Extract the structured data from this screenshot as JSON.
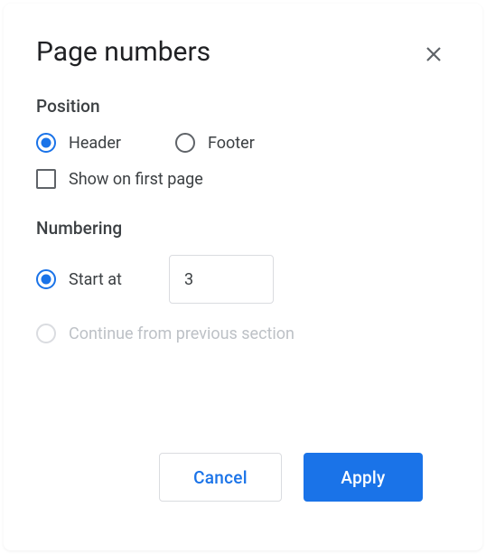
{
  "dialog": {
    "title": "Page numbers"
  },
  "position": {
    "section_label": "Position",
    "header_label": "Header",
    "footer_label": "Footer",
    "selected": "header",
    "show_first_label": "Show on first page",
    "show_first_checked": false
  },
  "numbering": {
    "section_label": "Numbering",
    "start_at_label": "Start at",
    "start_at_value": "3",
    "continue_label": "Continue from previous section",
    "selected": "start_at",
    "continue_enabled": false
  },
  "buttons": {
    "cancel": "Cancel",
    "apply": "Apply"
  }
}
